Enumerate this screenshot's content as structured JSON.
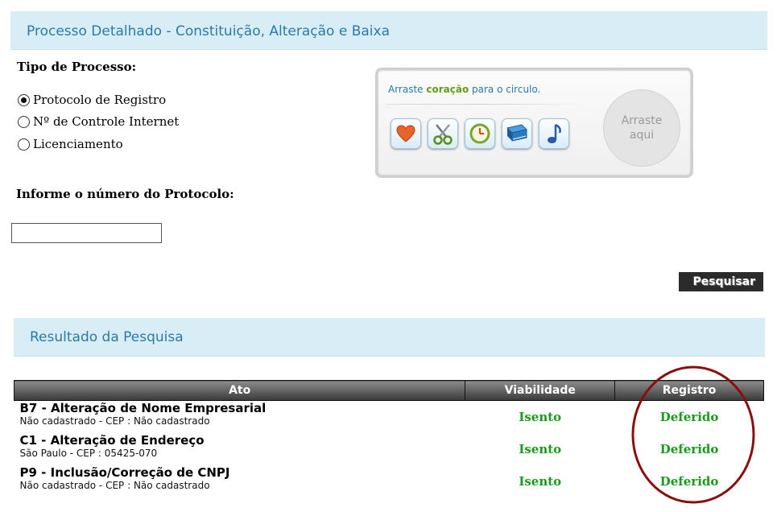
{
  "header": {
    "title": "Processo Detalhado - Constituição, Alteração e Baixa"
  },
  "form": {
    "tipo_label": "Tipo de Processo:",
    "options": [
      {
        "label": "Protocolo de Registro",
        "checked": true
      },
      {
        "label": "Nº de Controle Internet",
        "checked": false
      },
      {
        "label": "Licenciamento",
        "checked": false
      }
    ],
    "protocol_label": "Informe o número do Protocolo:",
    "protocol_value": "",
    "search_button": "Pesquisar"
  },
  "captcha": {
    "text_before": "Arraste ",
    "keyword": "coração",
    "text_after": " para o circulo.",
    "icons": [
      "heart-icon",
      "scissors-icon",
      "clock-icon",
      "book-icon",
      "music-note-icon"
    ],
    "drop_line1": "Arraste",
    "drop_line2": "aqui"
  },
  "result": {
    "title": "Resultado da Pesquisa",
    "columns": [
      "Ato",
      "Viabilidade",
      "Registro"
    ],
    "rows": [
      {
        "code": "B7",
        "title": " - Alteração de Nome Empresarial",
        "sub": "Não cadastrado - CEP : Não cadastrado",
        "viabilidade": "Isento",
        "registro": "Deferido"
      },
      {
        "code": "C1",
        "title": " - Alteração de Endereço",
        "sub": "São Paulo - CEP : 05425-070",
        "viabilidade": "Isento",
        "registro": "Deferido"
      },
      {
        "code": "P9",
        "title": " - Inclusão/Correção de CNPJ",
        "sub": "Não cadastrado - CEP : Não cadastrado",
        "viabilidade": "Isento",
        "registro": "Deferido"
      }
    ]
  },
  "colors": {
    "header_bg": "#d9edf7",
    "header_text": "#2a7aa8",
    "status_green": "#1a9b1a",
    "annotation_red": "#8b0e0e"
  }
}
